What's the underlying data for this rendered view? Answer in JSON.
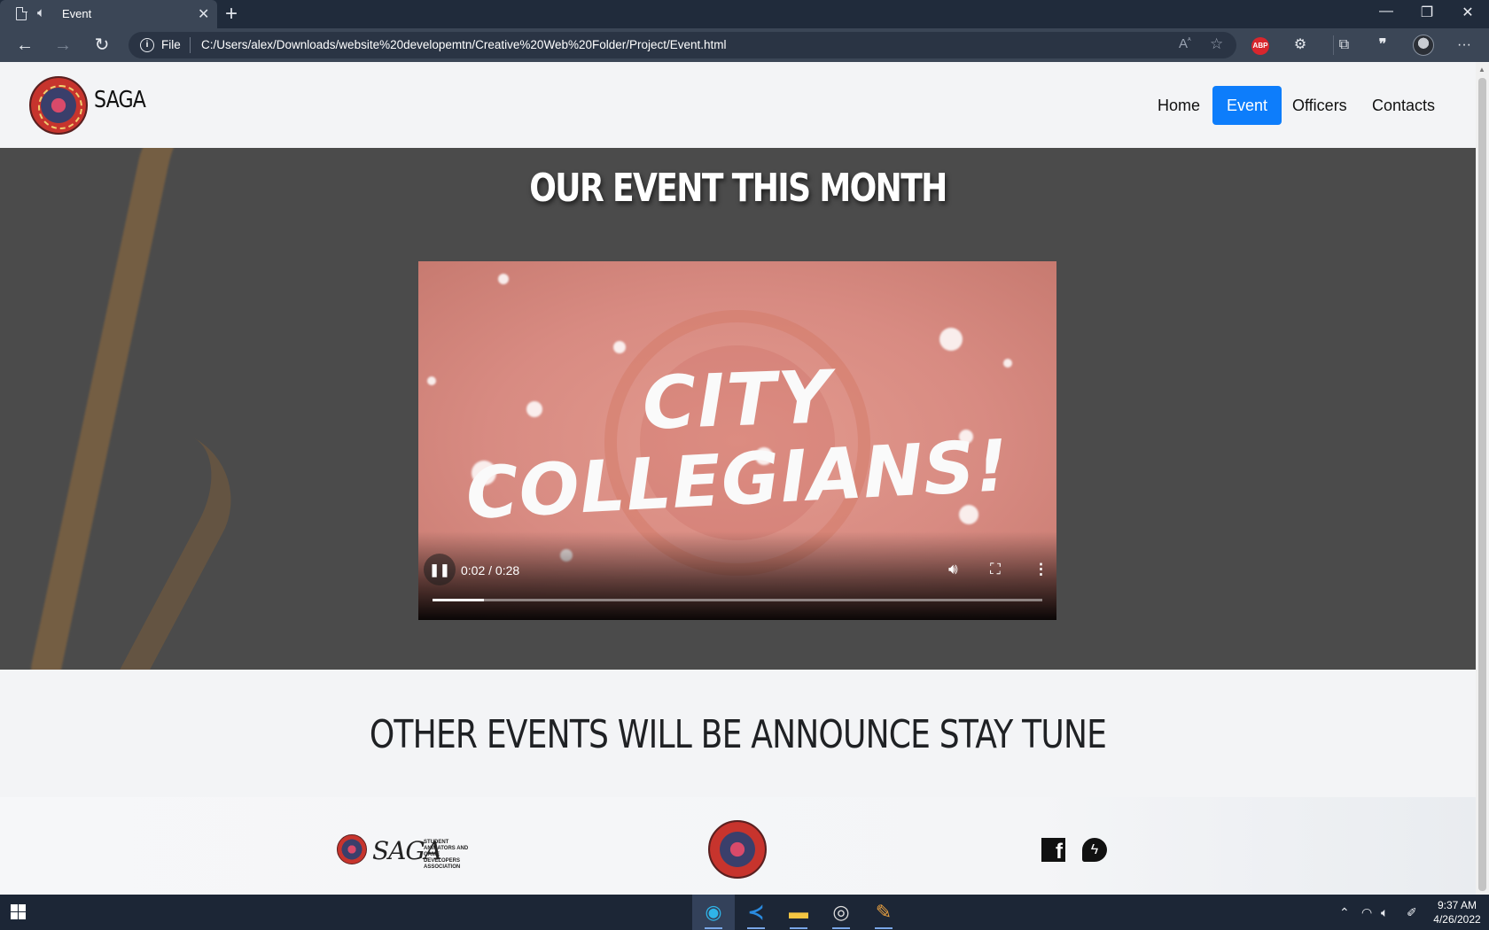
{
  "browser": {
    "tab_title": "Event",
    "address_scheme": "File",
    "url": "C:/Users/alex/Downloads/website%20developemtn/Creative%20Web%20Folder/Project/Event.html",
    "abp_label": "ABP"
  },
  "site": {
    "brand": "SAGA",
    "nav": [
      {
        "label": "Home",
        "active": false
      },
      {
        "label": "Event",
        "active": true
      },
      {
        "label": "Officers",
        "active": false
      },
      {
        "label": "Contacts",
        "active": false
      }
    ],
    "hero_title": "OUR EVENT THIS MONTH",
    "video": {
      "line1": "CITY",
      "line2": "COLLEGIANS!",
      "time": "0:02 / 0:28",
      "progress": 0.085
    },
    "announcement": "OTHER EVENTS WILL BE ANNOUNCE STAY TUNE",
    "footer": {
      "wordmark": "SAGA",
      "wordmark_sub": "STUDENT ANIMATORS AND GAME DEVELOPERS ASSOCIATION",
      "social": [
        "facebook",
        "messenger"
      ]
    }
  },
  "taskbar": {
    "apps": [
      "edge",
      "vscode",
      "file-explorer",
      "obs",
      "paint"
    ],
    "time": "9:37 AM",
    "date": "4/26/2022"
  },
  "colors": {
    "accent": "#0d7dfb",
    "hero_bg": "#4b4b4b",
    "chrome_bg": "#3b4656"
  }
}
